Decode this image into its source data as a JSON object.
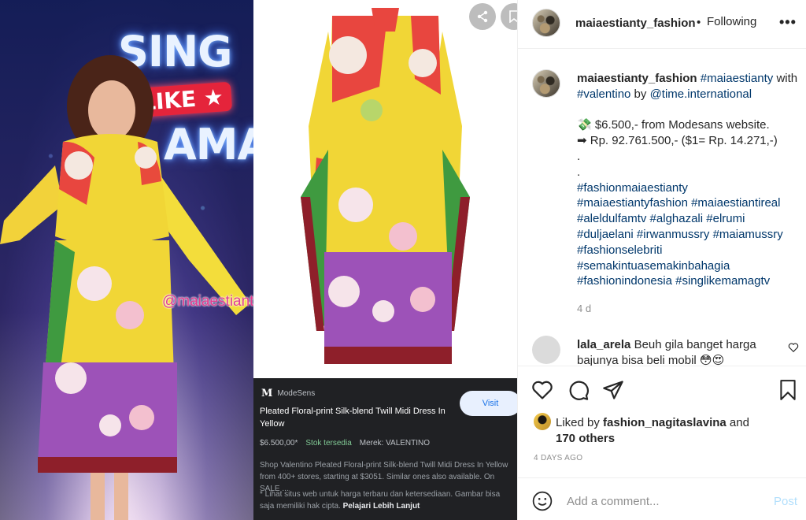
{
  "header": {
    "username": "maiaestianty_fashion",
    "dot": "•",
    "follow_state": "Following",
    "more": "•••"
  },
  "media": {
    "watermark": "@maiaestianty_fashion",
    "neon_sign": {
      "line1": "SING",
      "line2": "LIKE ★",
      "line3": "AMA"
    },
    "search_card": {
      "source_logo": "M",
      "source": "ModeSens",
      "title": "Pleated Floral-print Silk-blend Twill Midi Dress In Yellow",
      "visit_label": "Visit",
      "price": "$6.500,00*",
      "stock": "Stok tersedia",
      "brand": "Merek: VALENTINO",
      "description": "Shop Valentino Pleated Floral-print Silk-blend Twill Midi Dress In Yellow from 400+ stores, starting at $3051. Similar ones also available. On SALE ...",
      "note": "* Lihat situs web untuk harga terbaru dan ketersediaan. Gambar bisa saja memiliki hak cipta.",
      "learn_more": "Pelajari Lebih Lanjut"
    }
  },
  "caption": {
    "username": "maiaestianty_fashion",
    "line1_tag1": "#maiaestianty",
    "line1_with": " with",
    "line2_tag": "#valentino",
    "line2_by": " by ",
    "line2_mention": "@time.international",
    "price_line": "💸 $6.500,- from Modesans website.",
    "idr_line": "➡ Rp. 92.761.500,- ($1= Rp. 14.271,-)",
    "dot1": ".",
    "dot2": ".",
    "hashtags": [
      "#fashionmaiaestianty",
      "#maiaestiantyfashion #maiaestiantireal",
      "#aleldulfamtv #alghazali #elrumi",
      "#duljaelani #irwanmussry #maiamussry",
      "#fashionselebriti",
      "#semakintuasemakinbahagia",
      "#fashionindonesia #singlikemamagtv"
    ],
    "age": "4 d"
  },
  "comment": {
    "username": "lala_arela",
    "text": " Beuh gila banget harga bajunya bisa beli mobil 😳😍"
  },
  "likes": {
    "prefix": "Liked by ",
    "liker": "fashion_nagitaslavina",
    "and": " and",
    "count": "170 others"
  },
  "post_time": "4 DAYS AGO",
  "comment_input": {
    "placeholder": "Add a comment...",
    "post_label": "Post"
  },
  "icons": [
    "share-icon",
    "bookmark-icon",
    "more-icon",
    "heart-icon",
    "comment-icon",
    "send-icon",
    "save-icon",
    "emoji-icon"
  ]
}
